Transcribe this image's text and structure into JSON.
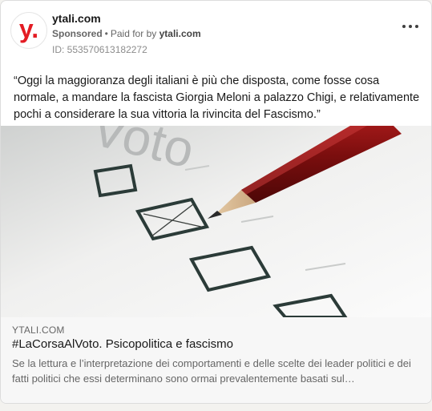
{
  "ad": {
    "company": "ytali.com",
    "avatar_letter": "y.",
    "sponsored_label": "Sponsored",
    "separator": "•",
    "paid_for_by": "Paid for by",
    "paid_for_company": "ytali.com",
    "ad_id": "ID: 553570613182272",
    "more_icon": "more-horizontal-icon"
  },
  "post": {
    "text": "“Oggi la maggioranza degli italiani è più che disposta, come fosse cosa normale, a mandare la fascista Giorgia Meloni a palazzo Chigi, e relativamente pochi a considerare la sua vittoria la rivincita del Fascismo.”"
  },
  "image": {
    "ballot_word": "Voto",
    "accent": "#e31b23"
  },
  "link": {
    "domain": "YTALI.COM",
    "title": "#LaCorsaAlVoto. Psicopolitica e fascismo",
    "description": "Se la lettura e l’interpretazione dei comportamenti e delle scelte dei leader politici e dei fatti politici che essi determinano sono ormai prevalentemente basati sul…"
  }
}
